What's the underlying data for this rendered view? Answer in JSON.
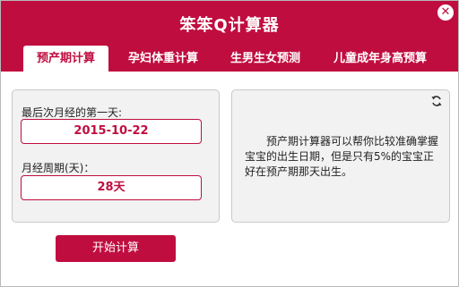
{
  "window": {
    "title": "笨笨Q计算器"
  },
  "tabs": [
    {
      "label": "预产期计算",
      "active": true
    },
    {
      "label": "孕妇体重计算",
      "active": false
    },
    {
      "label": "生男生女预测",
      "active": false
    },
    {
      "label": "儿童成年身高预算",
      "active": false
    }
  ],
  "form": {
    "last_period_label": "最后次月经的第一天:",
    "last_period_value": "2015-10-22",
    "cycle_label": "月经周期(天)：",
    "cycle_value": "28天"
  },
  "info": {
    "description": "预产期计算器可以帮你比较准确掌握宝宝的出生日期，但是只有5%的宝宝正好在预产期那天出生。"
  },
  "actions": {
    "start_label": "开始计算"
  },
  "icons": {
    "close": "close-icon",
    "refresh": "refresh-icon"
  },
  "colors": {
    "accent": "#c00d3f",
    "panel_bg": "#f2f2f2"
  }
}
